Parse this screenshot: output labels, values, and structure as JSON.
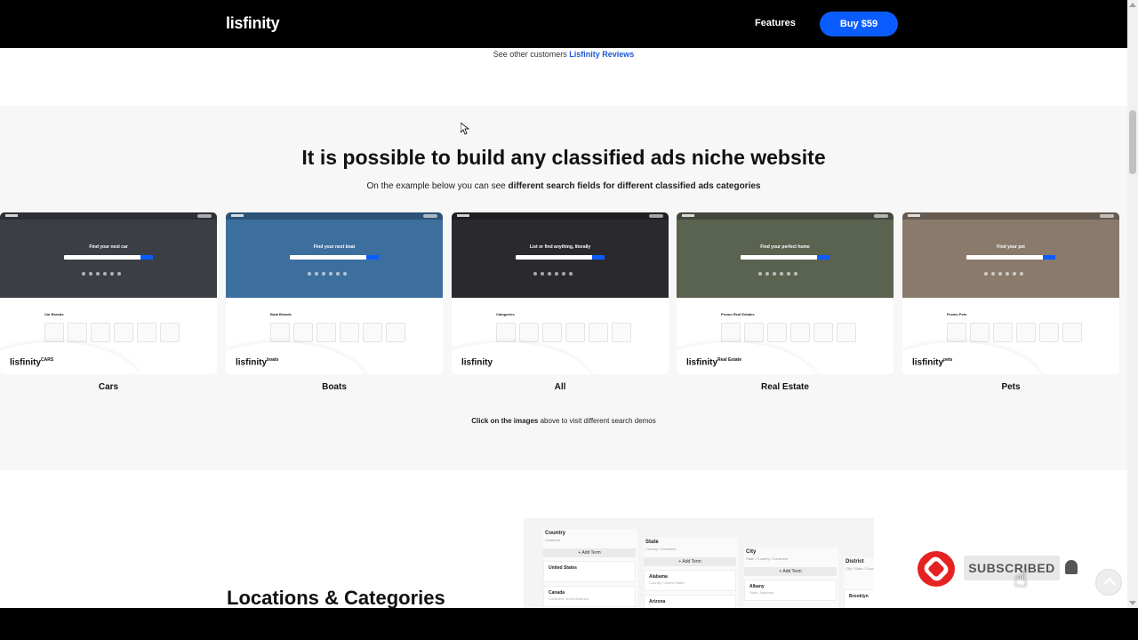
{
  "header": {
    "logo": "lisfinity",
    "nav_features": "Features",
    "buy_label": "Buy $59"
  },
  "reviews": {
    "prefix": "See other customers",
    "link": "Lisfinity Reviews"
  },
  "niche": {
    "title": "It is possible to build any classified ads niche website",
    "subtitle_prefix": "On the example below you can see",
    "subtitle_bold": "different search fields for different classified ads categories",
    "hint_bold": "Click on the images",
    "hint_rest": "above to visit different search demos",
    "cards": [
      {
        "label": "Cars",
        "tagline": "Find your next car",
        "cat_title": "Car Brands",
        "logo_tag": "CARS",
        "hero_color": "#3b3f45"
      },
      {
        "label": "Boats",
        "tagline": "Find your next boat",
        "cat_title": "Boat Brands",
        "logo_tag": "boats",
        "hero_color": "#3d6f9e"
      },
      {
        "label": "All",
        "tagline": "List or find anything, literally",
        "cat_title": "Categories",
        "logo_tag": "",
        "hero_color": "#2a2a2e"
      },
      {
        "label": "Real Estate",
        "tagline": "Find your perfect home",
        "cat_title": "Promo Real Estates",
        "logo_tag": "Real Estate",
        "hero_color": "#5a6250"
      },
      {
        "label": "Pets",
        "tagline": "Find your pet",
        "cat_title": "Promo Pets",
        "logo_tag": "pets",
        "hero_color": "#8a7a6c"
      }
    ]
  },
  "locations": {
    "title": "Locations & Categories",
    "columns": [
      {
        "header": "Country",
        "sub": "Continent",
        "add": "+ Add Term",
        "items": [
          {
            "name": "United States",
            "sub": ""
          },
          {
            "name": "Canada",
            "sub": "Continent: North America"
          }
        ]
      },
      {
        "header": "State",
        "sub": "Country / Continent",
        "add": "+ Add Term",
        "items": [
          {
            "name": "Alabama",
            "sub": "Country: United States"
          },
          {
            "name": "Arizona",
            "sub": ""
          }
        ]
      },
      {
        "header": "City",
        "sub": "State / Country / Continent",
        "add": "+ Add Term",
        "items": [
          {
            "name": "Albany",
            "sub": "State: Alabama"
          }
        ]
      },
      {
        "header": "District",
        "sub": "City / State / Country",
        "add": "",
        "items": [
          {
            "name": "Brooklyn",
            "sub": ""
          }
        ]
      }
    ]
  },
  "overlay": {
    "subscribed_label": "SUBSCRIBED"
  },
  "colors": {
    "accent": "#0b5cff",
    "link": "#1a57d6",
    "subscribe_red": "#e52222"
  }
}
